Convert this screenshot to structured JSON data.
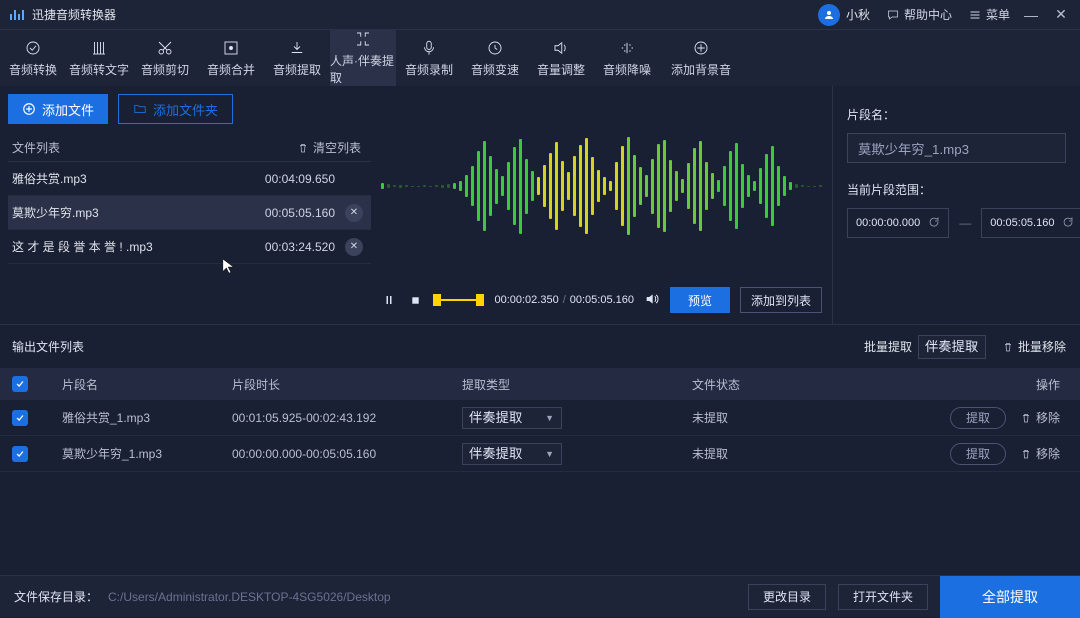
{
  "titlebar": {
    "app_name": "迅捷音频转换器",
    "username": "小秋",
    "help_label": "帮助中心",
    "menu_label": "菜单"
  },
  "toolbar": {
    "items": [
      "音频转换",
      "音频转文字",
      "音频剪切",
      "音频合并",
      "音频提取",
      "人声·伴奏提取",
      "音频录制",
      "音频变速",
      "音量调整",
      "音频降噪",
      "添加背景音"
    ],
    "active_index": 5
  },
  "left": {
    "add_file": "添加文件",
    "add_folder": "添加文件夹",
    "list_title": "文件列表",
    "clear_label": "清空列表",
    "files": [
      {
        "name": "雅俗共赏.mp3",
        "duration": "00:04:09.650",
        "removable": false
      },
      {
        "name": "莫欺少年穷.mp3",
        "duration": "00:05:05.160",
        "removable": true
      },
      {
        "name": "这 才 是 段 誉 本 誉 ! .mp3",
        "duration": "00:03:24.520",
        "removable": true
      }
    ],
    "selected_index": 1
  },
  "player": {
    "current": "00:00:02.350",
    "total": "00:05:05.160",
    "preview": "预览",
    "add_to_list": "添加到列表"
  },
  "right": {
    "name_label": "片段名：",
    "name_value": "莫欺少年穷_1.mp3",
    "range_label": "当前片段范围：",
    "start": "00:00:00.000",
    "end": "00:05:05.160"
  },
  "output": {
    "title": "输出文件列表",
    "batch_label": "批量提取",
    "batch_option": "伴奏提取",
    "batch_remove": "批量移除",
    "cols": {
      "name": "片段名",
      "dur": "片段时长",
      "type": "提取类型",
      "state": "文件状态",
      "op": "操作"
    },
    "rows": [
      {
        "name": "雅俗共赏_1.mp3",
        "dur": "00:01:05.925-00:02:43.192",
        "type": "伴奏提取",
        "state": "未提取",
        "extract": "提取",
        "remove": "移除"
      },
      {
        "name": "莫欺少年穷_1.mp3",
        "dur": "00:00:00.000-00:05:05.160",
        "type": "伴奏提取",
        "state": "未提取",
        "extract": "提取",
        "remove": "移除"
      }
    ]
  },
  "footer": {
    "save_label": "文件保存目录：",
    "path": "C:/Users/Administrator.DESKTOP-4SG5026/Desktop",
    "change_dir": "更改目录",
    "open_dir": "打开文件夹",
    "extract_all": "全部提取"
  },
  "waveform": {
    "bars": [
      6,
      4,
      2,
      3,
      2,
      1,
      1,
      2,
      1,
      2,
      3,
      4,
      6,
      10,
      22,
      40,
      70,
      90,
      60,
      35,
      20,
      48,
      78,
      95,
      55,
      30,
      18,
      42,
      66,
      88,
      50,
      28,
      60,
      82,
      96,
      58,
      32,
      18,
      10,
      48,
      80,
      98,
      62,
      38,
      22,
      55,
      84,
      92,
      52,
      30,
      14,
      46,
      76,
      90,
      48,
      26,
      12,
      40,
      70,
      86,
      44,
      22,
      10,
      36,
      64,
      80,
      40,
      20,
      8,
      4,
      2,
      1,
      1,
      2
    ]
  }
}
